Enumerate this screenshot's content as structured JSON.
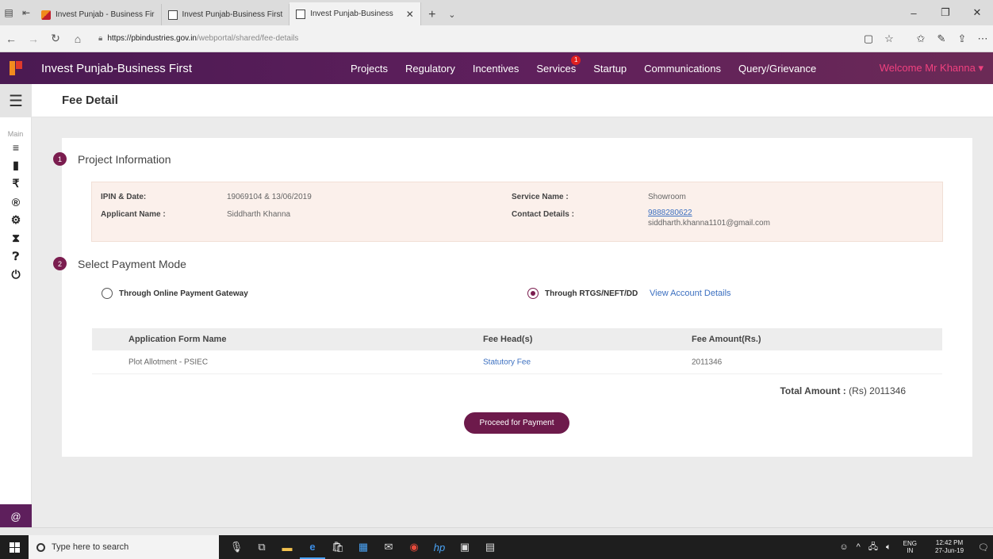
{
  "browser": {
    "tabs": [
      {
        "title": "Invest Punjab - Business Fir",
        "active": false
      },
      {
        "title": "Invest Punjab-Business First",
        "active": false
      },
      {
        "title": "Invest Punjab-Business",
        "active": true
      }
    ],
    "url_host": "https://pbindustries.gov.in",
    "url_path": "/webportal/shared/fee-details"
  },
  "app": {
    "title": "Invest Punjab-Business First",
    "nav": [
      "Projects",
      "Regulatory",
      "Incentives",
      "Services",
      "Startup",
      "Communications",
      "Query/Grievance"
    ],
    "services_badge": "1",
    "welcome": "Welcome Mr Khanna ▾"
  },
  "sidebar": {
    "heading": "Main",
    "icons": [
      "menu-icon",
      "file-icon",
      "rupee-icon",
      "registered-icon",
      "cogs-icon",
      "hourglass-icon",
      "help-icon",
      "power-icon"
    ]
  },
  "page": {
    "title": "Fee Detail"
  },
  "project_info": {
    "step": "1",
    "heading": "Project Information",
    "ipin_label": "IPIN & Date:",
    "ipin_value": "19069104 & 13/06/2019",
    "service_label": "Service Name :",
    "service_value": "Showroom",
    "applicant_label": "Applicant Name :",
    "applicant_value": "Siddharth Khanna",
    "contact_label": "Contact Details :",
    "contact_phone": "9888280622",
    "contact_email": "siddharth.khanna1101@gmail.com"
  },
  "payment_mode": {
    "step": "2",
    "heading": "Select Payment Mode",
    "option_online": "Through Online Payment Gateway",
    "option_rtgs": "Through RTGS/NEFT/DD",
    "selected": "rtgs",
    "account_link": "View Account Details"
  },
  "fee_table": {
    "headers": [
      "Application Form Name",
      "Fee Head(s)",
      "Fee Amount(Rs.)"
    ],
    "rows": [
      {
        "form": "Plot Allotment - PSIEC",
        "head": "Statutory Fee",
        "amount": "2011346"
      }
    ]
  },
  "total": {
    "label": "Total Amount :",
    "currency": "(Rs)",
    "value": "2011346"
  },
  "proceed_button": "Proceed for Payment",
  "taskbar": {
    "search_placeholder": "Type here to search",
    "lang_top": "ENG",
    "lang_bottom": "IN",
    "time": "12:42 PM",
    "date": "27-Jun-19"
  }
}
